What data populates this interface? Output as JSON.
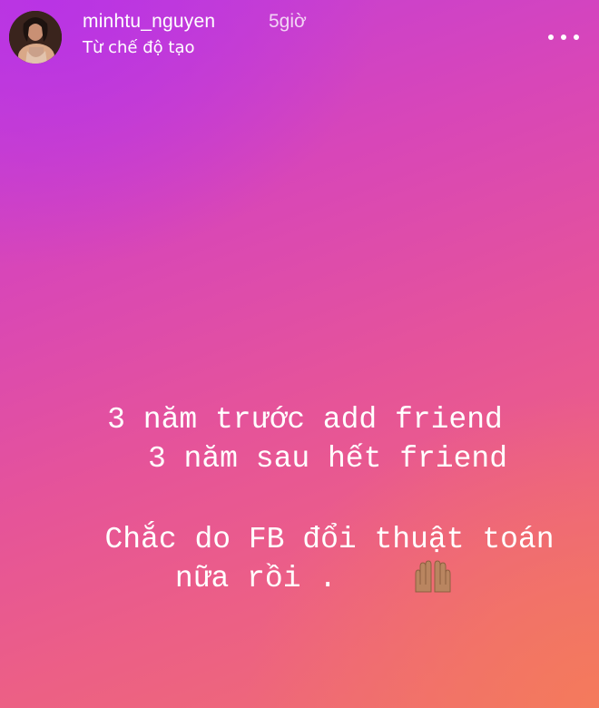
{
  "story": {
    "username": "minhtu_nguyen",
    "time_ago": "5giờ",
    "subtitle": "Từ chế độ tạo",
    "lines": [
      "3 năm trước add friend",
      "3 năm sau hết friend",
      "Chắc do FB đổi thuật toán",
      "nữa rồi ."
    ],
    "emoji": "raised-hands-icon"
  },
  "colors": {
    "top_left": "#b934e4",
    "middle": "#e5539a",
    "bottom_right": "#f47a5c"
  }
}
